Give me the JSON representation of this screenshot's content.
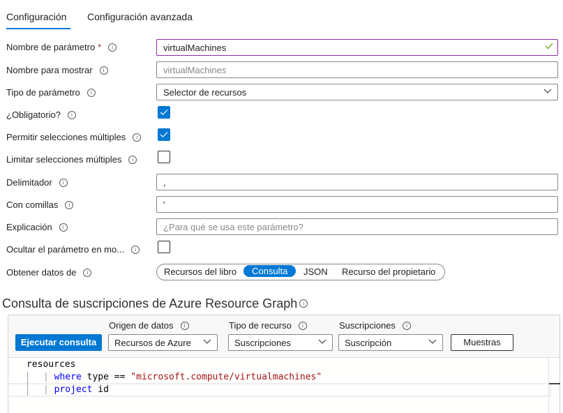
{
  "tabs": [
    {
      "label": "Configuración",
      "active": true
    },
    {
      "label": "Configuración avanzada",
      "active": false
    }
  ],
  "form": {
    "parameter_name": {
      "label": "Nombre de parámetro",
      "required_mark": "*",
      "value": "virtualMachines",
      "valid": true
    },
    "display_name": {
      "label": "Nombre para mostrar",
      "placeholder": "virtualMachines"
    },
    "parameter_type": {
      "label": "Tipo de parámetro",
      "value": "Selector de recursos"
    },
    "required": {
      "label": "¿Obligatorio?",
      "checked": true
    },
    "allow_multiple": {
      "label": "Permitir selecciones múltiples",
      "checked": true
    },
    "limit_multiple": {
      "label": "Limitar selecciones múltiples",
      "checked": false
    },
    "delimiter": {
      "label": "Delimitador",
      "value": ","
    },
    "quote_with": {
      "label": "Con comillas",
      "value": "'"
    },
    "explanation": {
      "label": "Explicación",
      "placeholder": "¿Para qué se usa este parámetro?"
    },
    "hide_parameter": {
      "label": "Ocultar el parámetro en mo...",
      "checked": false
    },
    "get_data_from": {
      "label": "Obtener datos de",
      "options": [
        "Recursos del libro",
        "Consulta",
        "JSON",
        "Recurso del propietario"
      ],
      "selected": "Consulta"
    }
  },
  "query_section": {
    "title": "Consulta de suscripciones de Azure Resource Graph",
    "run_button": "Ejecutar consulta",
    "data_source": {
      "label": "Origen de datos",
      "value": "Recursos de Azure"
    },
    "resource_type": {
      "label": "Tipo de recurso",
      "value": "Suscripciones"
    },
    "subscriptions": {
      "label": "Suscripciones",
      "value": "Suscripción"
    },
    "samples_button": "Muestras",
    "code": {
      "line1": "resources",
      "line2_pipe": "| ",
      "line2_kw": "where",
      "line2_rest": " type == ",
      "line2_str": "\"microsoft.compute/virtualmachines\"",
      "line3_pipe": "| ",
      "line3_kw": "project",
      "line3_rest": " id"
    }
  },
  "colors": {
    "accent": "#0078d4",
    "focus_border": "#8a2da5",
    "valid_check": "#57a300",
    "required_star": "#a4262c"
  }
}
